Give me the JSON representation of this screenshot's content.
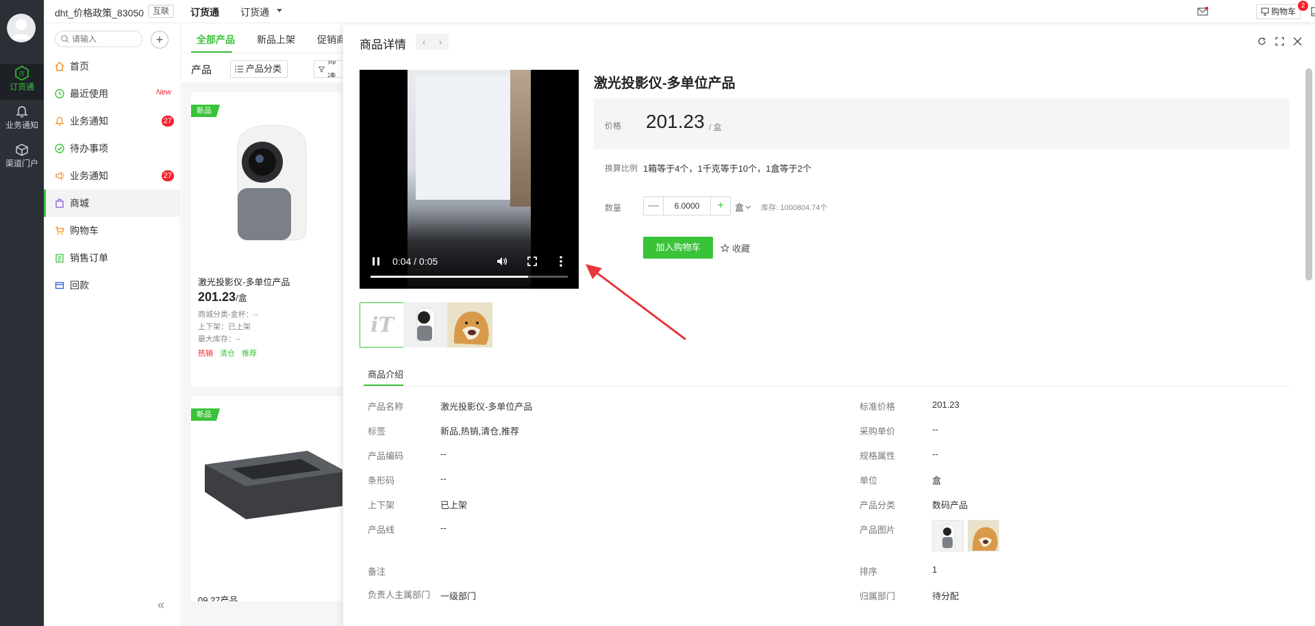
{
  "rail": {
    "items": [
      {
        "label": "订货通",
        "icon": "app-logo-icon"
      },
      {
        "label": "业务通知",
        "icon": "bell-icon"
      },
      {
        "label": "渠道门户",
        "icon": "cube-icon"
      }
    ]
  },
  "topbar": {
    "org": "dht_价格政策_83050",
    "org_tag": "互联",
    "app_title": "订货通",
    "app_switch": "订货通",
    "cart_label": "购物车",
    "cart_count": "2"
  },
  "sidebar": {
    "search_placeholder": "请输入",
    "items": [
      {
        "label": "首页",
        "icon": "home-icon"
      },
      {
        "label": "最近使用",
        "icon": "clock-icon",
        "new": "New"
      },
      {
        "label": "业务通知",
        "icon": "bell-icon",
        "badge": "27"
      },
      {
        "label": "待办事项",
        "icon": "check-circle-icon"
      },
      {
        "label": "业务通知",
        "icon": "megaphone-icon",
        "badge": "27"
      },
      {
        "label": "商城",
        "icon": "shopping-bag-icon"
      },
      {
        "label": "购物车",
        "icon": "cart-icon"
      },
      {
        "label": "销售订单",
        "icon": "clipboard-icon"
      },
      {
        "label": "回款",
        "icon": "wallet-icon"
      }
    ],
    "collapse_glyph": "«"
  },
  "main": {
    "tabs": [
      "全部产品",
      "新品上架",
      "促销商"
    ],
    "toolbar_title": "产品",
    "category_btn": "产品分类",
    "filter_btn": "筛选",
    "cards": [
      {
        "new_tag": "新品",
        "name": "激光投影仪-多单位产品",
        "price": "201.23",
        "unit": "/盒",
        "meta": [
          "商城分类-金杯：--",
          "上下架：已上架",
          "最大库存：--"
        ],
        "tags": [
          "热销",
          "清仓",
          "推荐"
        ]
      },
      {
        "new_tag": "新品",
        "name": "09.27产品"
      }
    ]
  },
  "detail": {
    "title": "商品详情",
    "product_title": "激光投影仪-多单位产品",
    "price_label": "价格",
    "price": "201.23",
    "price_unit": "/ 盒",
    "ratio_label": "换算比例",
    "ratio_value": "1箱等于4个，1千克等于10个，1盒等于2个",
    "qty_label": "数量",
    "qty_value": "6.0000",
    "qty_unit": "盒",
    "stock": "库存: 1000804.74个",
    "add_cart": "加入购物车",
    "favorite": "收藏",
    "video_time": "0:04 / 0:05",
    "video_progress": 0.8,
    "intro_tab": "商品介绍",
    "left_fields": [
      {
        "label": "产品名称",
        "value": "激光投影仪-多单位产品"
      },
      {
        "label": "标签",
        "value": "新品,热销,清仓,推荐"
      },
      {
        "label": "产品编码",
        "value": "--"
      },
      {
        "label": "条形码",
        "value": "--"
      },
      {
        "label": "上下架",
        "value": "已上架"
      },
      {
        "label": "产品线",
        "value": "--"
      },
      {
        "label": "备注",
        "value": ""
      },
      {
        "label": "负责人主属部门",
        "value": "一级部门"
      }
    ],
    "right_fields": [
      {
        "label": "标准价格",
        "value": "201.23"
      },
      {
        "label": "采购单价",
        "value": "--"
      },
      {
        "label": "规格属性",
        "value": "--"
      },
      {
        "label": "单位",
        "value": "盒"
      },
      {
        "label": "产品分类",
        "value": "数码产品"
      },
      {
        "label": "产品图片",
        "value": ""
      },
      {
        "label": "排序",
        "value": "1"
      },
      {
        "label": "归属部门",
        "value": "待分配"
      }
    ]
  },
  "colors": {
    "accent": "#38c338",
    "badge": "#f5222d",
    "rail_bg": "#2b2f36",
    "arrow": "#e8373b"
  }
}
